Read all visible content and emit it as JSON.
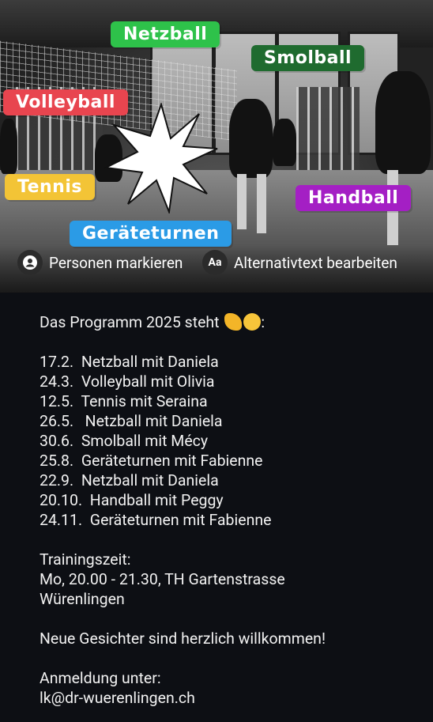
{
  "photo": {
    "tags": [
      {
        "label": "Netzball",
        "color": "#2ec24a"
      },
      {
        "label": "Smolball",
        "color": "#1f6b2f"
      },
      {
        "label": "Volleyball",
        "color": "#e8454f"
      },
      {
        "label": "Tennis",
        "color": "#f3c436"
      },
      {
        "label": "Handball",
        "color": "#a41fc4"
      },
      {
        "label": "Geräteturnen",
        "color": "#2b9be6"
      }
    ],
    "actions": {
      "tag_people": "Personen markieren",
      "alt_text_icon": "Aa",
      "alt_text": "Alternativtext bearbeiten"
    }
  },
  "post": {
    "heading": "Das Programm 2025 steht",
    "schedule": [
      "17.2.  Netzball mit Daniela",
      "24.3.  Volleyball mit Olivia",
      "12.5.  Tennis mit Seraina",
      "26.5.   Netzball mit Daniela",
      "30.6.  Smolball mit Mécy",
      "25.8.  Geräteturnen mit Fabienne",
      "22.9.  Netzball mit Daniela",
      "20.10.  Handball mit Peggy",
      "24.11.  Geräteturnen mit Fabienne"
    ],
    "training_label": "Trainingszeit:",
    "training_time": "Mo, 20.00 - 21.30, TH Gartenstrasse",
    "training_place": "Würenlingen",
    "welcome": "Neue Gesichter sind herzlich willkommen!",
    "signup_label": "Anmeldung unter:",
    "signup_email": "lk@dr-wuerenlingen.ch"
  },
  "icons": {
    "flexed_biceps": "flexed-biceps-emoji",
    "grin": "grinning-face-emoji"
  }
}
